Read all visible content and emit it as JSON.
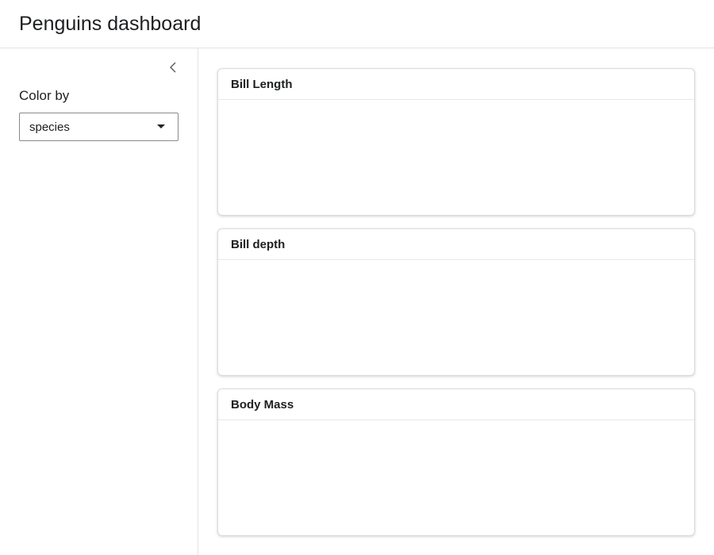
{
  "header": {
    "title": "Penguins dashboard"
  },
  "sidebar": {
    "collapse_icon": "chevron-left-icon",
    "color_by": {
      "label": "Color by",
      "selected": "species"
    }
  },
  "cards": [
    {
      "title": "Bill Length"
    },
    {
      "title": "Bill depth"
    },
    {
      "title": "Body Mass"
    }
  ]
}
